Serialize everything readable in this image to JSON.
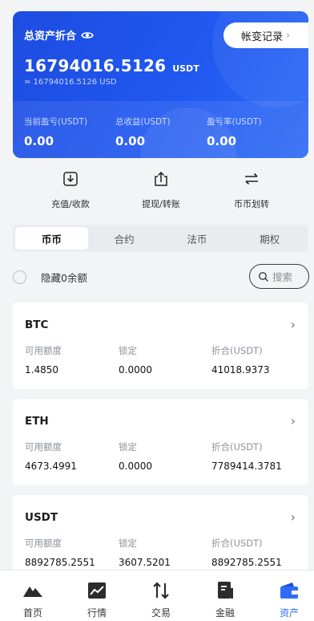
{
  "hero": {
    "title": "总资产折合",
    "ledger_label": "帐变记录",
    "total_value": "16794016.5126",
    "total_unit": "USDT",
    "total_usd": "≈ 16794016.5126 USD",
    "stats": [
      {
        "label": "当前盈亏(USDT)",
        "value": "0.00"
      },
      {
        "label": "总收益(USDT)",
        "value": "0.00"
      },
      {
        "label": "盈亏率(USDT)",
        "value": "0.00"
      }
    ]
  },
  "actions": [
    {
      "label": "充值/收款",
      "icon": "download-icon"
    },
    {
      "label": "提现/转账",
      "icon": "upload-icon"
    },
    {
      "label": "币币划转",
      "icon": "transfer-icon"
    }
  ],
  "tabs": [
    {
      "label": "币币",
      "active": true
    },
    {
      "label": "合约",
      "active": false
    },
    {
      "label": "法币",
      "active": false
    },
    {
      "label": "期权",
      "active": false
    }
  ],
  "filter": {
    "hide_zero_label": "隐藏0余额",
    "search_placeholder": "搜索"
  },
  "assets": [
    {
      "coin": "BTC",
      "available_label": "可用额度",
      "available": "1.4850",
      "locked_label": "锁定",
      "locked": "0.0000",
      "equiv_label": "折合(USDT)",
      "equiv": "41018.9373"
    },
    {
      "coin": "ETH",
      "available_label": "可用额度",
      "available": "4673.4991",
      "locked_label": "锁定",
      "locked": "0.0000",
      "equiv_label": "折合(USDT)",
      "equiv": "7789414.3781"
    },
    {
      "coin": "USDT",
      "available_label": "可用额度",
      "available": "8892785.2551",
      "locked_label": "锁定",
      "locked": "3607.5201",
      "equiv_label": "折合(USDT)",
      "equiv": "8892785.2551"
    }
  ],
  "nav": [
    {
      "label": "首页",
      "icon": "home-mountain-icon"
    },
    {
      "label": "行情",
      "icon": "chart-icon"
    },
    {
      "label": "交易",
      "icon": "trade-arrows-icon"
    },
    {
      "label": "金融",
      "icon": "finance-book-icon"
    },
    {
      "label": "资产",
      "icon": "wallet-icon",
      "active": true
    }
  ],
  "colors": {
    "primary": "#2058f0",
    "active_nav": "#2f6cf6",
    "background": "#f2f4f6"
  }
}
